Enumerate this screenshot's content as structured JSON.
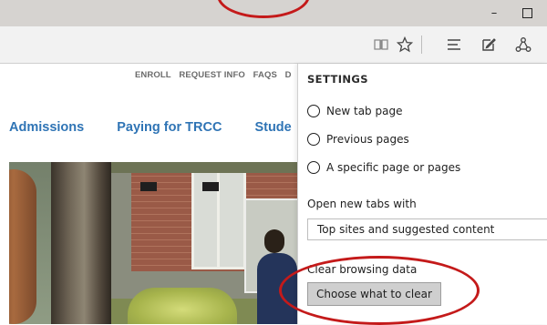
{
  "window": {
    "minimize_glyph": "–"
  },
  "toolbar": {
    "icons": [
      "reading-view-icon",
      "favorites-star-icon",
      "hub-icon",
      "web-note-icon",
      "share-icon"
    ]
  },
  "webpage": {
    "top_nav": [
      "ENROLL",
      "REQUEST INFO",
      "FAQS",
      "D"
    ],
    "main_nav": [
      "Admissions",
      "Paying for TRCC",
      "Stude"
    ]
  },
  "settings": {
    "title": "SETTINGS",
    "open_with_options": [
      "New tab page",
      "Previous pages",
      "A specific page or pages"
    ],
    "new_tabs_label": "Open new tabs with",
    "new_tabs_value": "Top sites and suggested content",
    "clear_label": "Clear browsing data",
    "clear_button": "Choose what to clear"
  },
  "colors": {
    "annotation": "#c41a1a",
    "link_blue": "#2f74b5"
  }
}
